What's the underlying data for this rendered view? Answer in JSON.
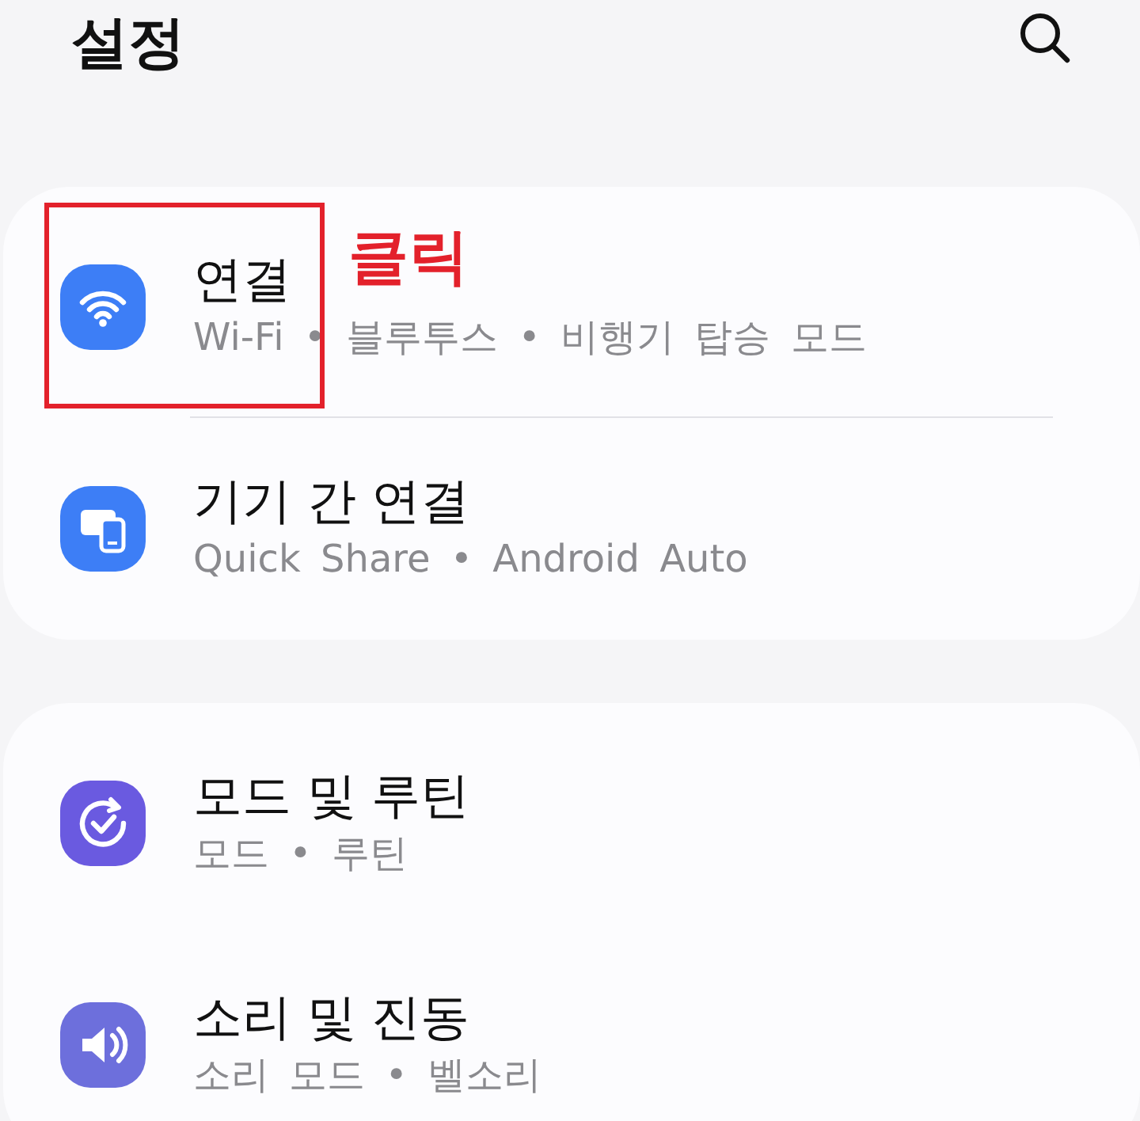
{
  "header": {
    "title": "설정"
  },
  "cards": [
    {
      "divider": true,
      "items": [
        {
          "kind": "wifi",
          "color": "#3d7ef6",
          "title": "연결",
          "subtitle": "Wi-Fi • 블루투스 • 비행기 탑승 모드"
        },
        {
          "kind": "devices",
          "color": "#3d7ef6",
          "title": "기기 간 연결",
          "subtitle": "Quick Share • Android Auto"
        }
      ]
    },
    {
      "divider": false,
      "items": [
        {
          "kind": "routine",
          "color": "#6a5ae0",
          "title": "모드 및 루틴",
          "subtitle": "모드 • 루틴"
        },
        {
          "kind": "sound",
          "color": "#6d6fdc",
          "title": "소리 및 진동",
          "subtitle": "소리 모드 • 벨소리"
        }
      ]
    }
  ],
  "annotation": {
    "label": "클릭"
  }
}
